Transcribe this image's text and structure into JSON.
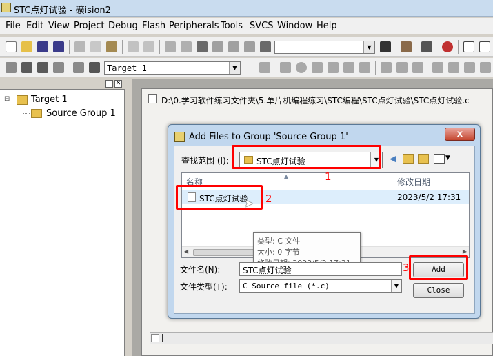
{
  "window": {
    "title": "STC点灯试验 - 礦ision2"
  },
  "menu": [
    "File",
    "Edit",
    "View",
    "Project",
    "Debug",
    "Flash",
    "Peripherals",
    "Tools",
    "SVCS",
    "Window",
    "Help"
  ],
  "toolbar": {
    "find_value": "",
    "target_select": "Target 1"
  },
  "project_tree": {
    "target": "Target 1",
    "group": "Source Group 1",
    "expander": "⊟"
  },
  "editor": {
    "path": "D:\\0.学习软件练习文件夹\\5.单片机编程练习\\STC编程\\STC点灯试验\\STC点灯试验.c"
  },
  "dialog": {
    "title": "Add Files to Group 'Source Group 1'",
    "close_glyph": "x",
    "look_in_label": "查找范围 (I):",
    "look_in_value": "STC点灯试验",
    "col_name": "名称",
    "col_date": "修改日期",
    "file": {
      "name": "STC点灯试验",
      "date": "2023/5/2 17:31"
    },
    "tooltip": {
      "type": "类型: C 文件",
      "size": "大小: 0 字节",
      "date": "修改日期: 2023/5/2 17:31"
    },
    "filename_label": "文件名(N):",
    "filename_value": "STC点灯试验",
    "filetype_label": "文件类型(T):",
    "filetype_value": "C Source file (*.c)",
    "add_button": "Add",
    "close_button": "Close"
  },
  "annotations": {
    "step1": "1",
    "step2": "2",
    "step3": "3"
  },
  "colors": {
    "highlight": "#ff0000",
    "selection": "#ddeefc"
  }
}
